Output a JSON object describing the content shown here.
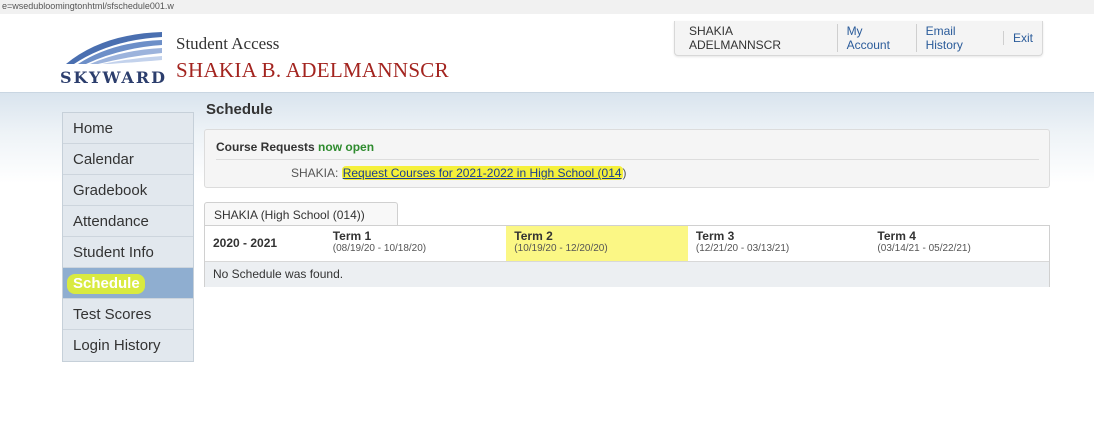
{
  "browser": {
    "url_fragment": "e=wsedubloomingtonhtml/sfschedule001.w"
  },
  "brand": {
    "logo_text": "SKYWARD",
    "app_title": "Student Access",
    "student_name": "SHAKIA B. ADELMANNSCR"
  },
  "topnav": {
    "user": "SHAKIA ADELMANNSCR",
    "my_account": "My Account",
    "email_history": "Email History",
    "exit": "Exit"
  },
  "sidebar": {
    "items": [
      {
        "label": "Home"
      },
      {
        "label": "Calendar"
      },
      {
        "label": "Gradebook"
      },
      {
        "label": "Attendance"
      },
      {
        "label": "Student Info"
      },
      {
        "label": "Schedule",
        "active": true
      },
      {
        "label": "Test Scores"
      },
      {
        "label": "Login History"
      }
    ]
  },
  "main": {
    "title": "Schedule",
    "course_requests": {
      "title": "Course Requests",
      "status": "now open",
      "student_prefix": "SHAKIA:",
      "link_text": "Request Courses for 2021-2022 in High School (014",
      "link_suffix": ")"
    },
    "schedule_tab": "SHAKIA  (High School (014))",
    "school_year": "2020 - 2021",
    "terms": [
      {
        "name": "Term 1",
        "dates": "(08/19/20 - 10/18/20)"
      },
      {
        "name": "Term 2",
        "dates": "(10/19/20 - 12/20/20)",
        "current": true
      },
      {
        "name": "Term 3",
        "dates": "(12/21/20 - 03/13/21)"
      },
      {
        "name": "Term 4",
        "dates": "(03/14/21 - 05/22/21)"
      }
    ],
    "empty_message": "No Schedule was found."
  },
  "colors": {
    "brand_red": "#a3241f",
    "link_blue": "#2a5b9a",
    "open_green": "#2e8b2e",
    "highlight_yellow": "#fbf785",
    "active_nav": "#8faed0"
  }
}
